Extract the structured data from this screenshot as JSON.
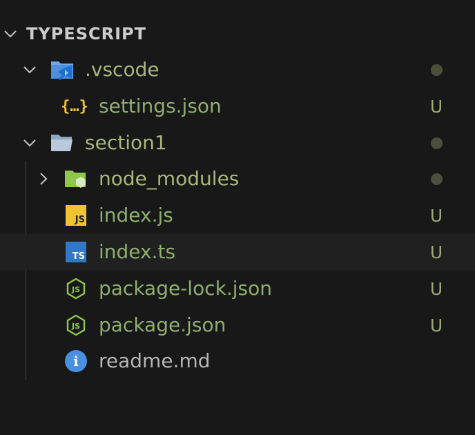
{
  "section": {
    "title": "TYPESCRIPT",
    "expanded": true
  },
  "tree": [
    {
      "name": ".vscode",
      "type": "folder",
      "icon": "vscode-folder-icon",
      "expanded": true,
      "status": "dot",
      "status_text": ""
    },
    {
      "name": "settings.json",
      "type": "file",
      "icon": "json-settings-icon",
      "icon_text": "{…}",
      "status": "text",
      "status_text": "U"
    },
    {
      "name": "section1",
      "type": "folder",
      "icon": "folder-open-icon",
      "expanded": true,
      "status": "dot",
      "status_text": ""
    },
    {
      "name": "node_modules",
      "type": "folder",
      "icon": "node-folder-icon",
      "expanded": false,
      "status": "dot",
      "status_text": ""
    },
    {
      "name": "index.js",
      "type": "file",
      "icon": "javascript-file-icon",
      "icon_text": "JS",
      "status": "text",
      "status_text": "U"
    },
    {
      "name": "index.ts",
      "type": "file",
      "icon": "typescript-file-icon",
      "icon_text": "TS",
      "status": "text",
      "status_text": "U",
      "hovered": true
    },
    {
      "name": "package-lock.json",
      "type": "file",
      "icon": "node-json-file-icon",
      "icon_text": "JS",
      "status": "text",
      "status_text": "U"
    },
    {
      "name": "package.json",
      "type": "file",
      "icon": "node-json-file-icon",
      "icon_text": "JS",
      "status": "text",
      "status_text": "U"
    },
    {
      "name": "readme.md",
      "type": "file",
      "icon": "info-icon",
      "icon_text": "i",
      "status": "none",
      "status_text": ""
    }
  ],
  "colors": {
    "background": "#181818",
    "hover_row": "#202020",
    "modified_text": "#a9b77a",
    "untracked_text": "#8fae6e",
    "status_dot": "#4b4f3c",
    "js_yellow": "#f1c232",
    "ts_blue": "#3178c6",
    "node_green": "#8cc84b",
    "info_blue": "#4a90e2",
    "folder_blue": "#6ea8e8"
  }
}
